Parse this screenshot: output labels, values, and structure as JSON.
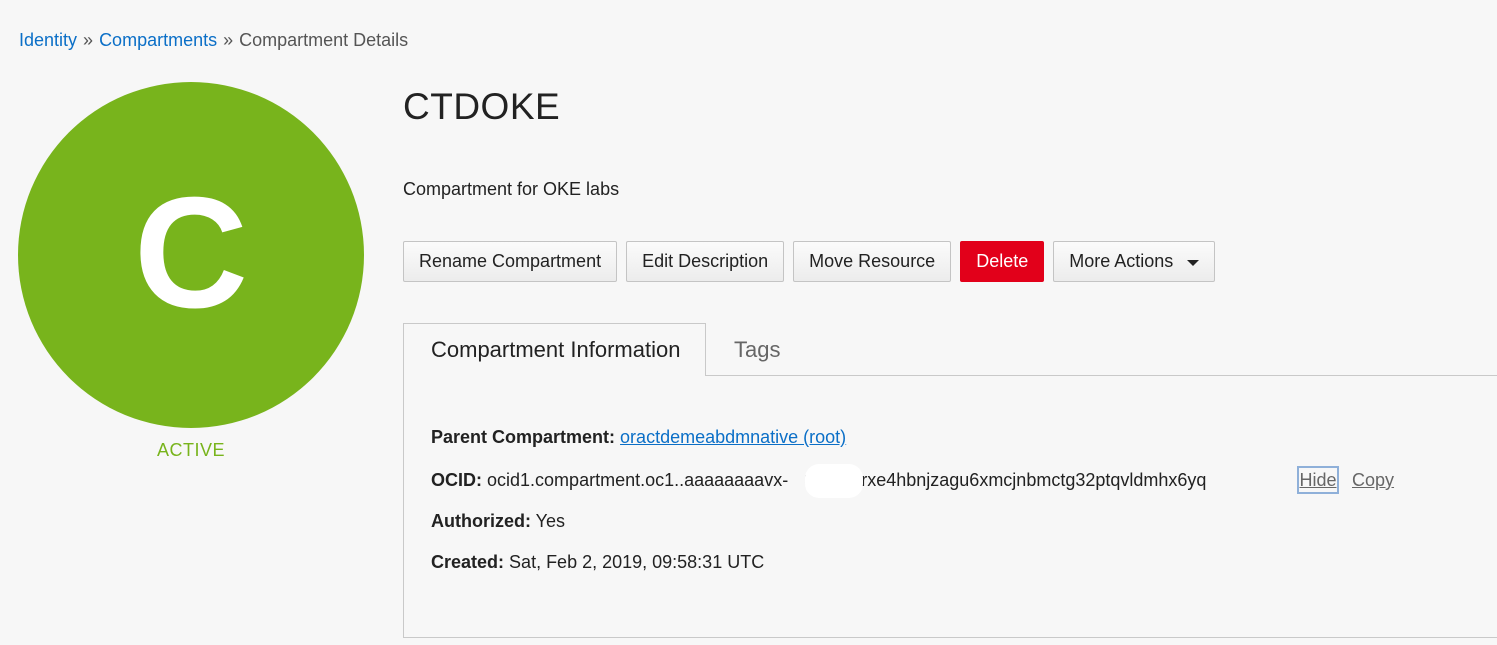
{
  "breadcrumb": {
    "items": [
      "Identity",
      "Compartments"
    ],
    "separator": "»",
    "current": "Compartment Details"
  },
  "avatar": {
    "letter": "C",
    "color": "#78b41c",
    "status": "ACTIVE"
  },
  "compartment": {
    "name": "CTDOKE",
    "description": "Compartment for OKE labs"
  },
  "actions": {
    "rename": "Rename Compartment",
    "edit_description": "Edit Description",
    "move_resource": "Move Resource",
    "delete": "Delete",
    "more_actions": "More Actions",
    "more_actions_icon": "caret-down-icon"
  },
  "tabs": {
    "info": "Compartment Information",
    "tags": "Tags"
  },
  "info": {
    "parent_label": "Parent Compartment:",
    "parent_value": "oractdemeabdmnative (root)",
    "ocid_label": "OCID:",
    "ocid_value": "ocid1.compartment.oc1..aaaaaaaavx-",
    "ocid_value_tail": "3j7iml4rxe4hbnjzagu6xmcjnbmctg32ptqvldmhx6yq",
    "hide_link": "Hide",
    "copy_link": "Copy",
    "authorized_label": "Authorized:",
    "authorized_value": "Yes",
    "created_label": "Created:",
    "created_value": "Sat, Feb 2, 2019, 09:58:31 UTC"
  },
  "colors": {
    "link": "#0b6fc7",
    "danger": "#e2001a",
    "active": "#78b41c"
  }
}
